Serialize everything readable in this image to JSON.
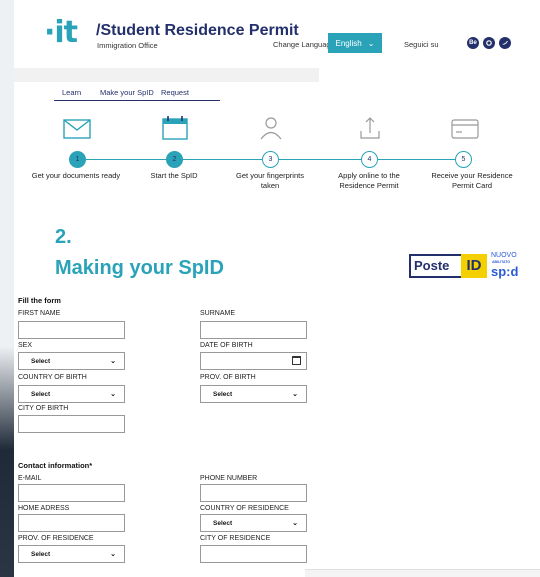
{
  "header": {
    "logo": "·it",
    "title": "/Student Residence Permit",
    "subtitle": "Immigration Office",
    "change_language": "Change Language",
    "language": "English",
    "follow_us": "Seguici su",
    "social": [
      "Be",
      "GitHub",
      "Twitter"
    ]
  },
  "tabs": [
    "Learn",
    "Make your SpID",
    "Request"
  ],
  "steps": [
    {
      "num": "1",
      "label": "Get your documents ready",
      "icon": "envelope-icon",
      "done": true
    },
    {
      "num": "2",
      "label": "Start the SpID",
      "icon": "calendar-icon",
      "done": true
    },
    {
      "num": "3",
      "label": "Get your fingerprints taken",
      "icon": "user-icon",
      "done": false
    },
    {
      "num": "4",
      "label": "Apply online to the Residence Permit",
      "icon": "upload-icon",
      "done": false
    },
    {
      "num": "5",
      "label": "Receive your Residence Permit Card",
      "icon": "card-icon",
      "done": false
    }
  ],
  "section": {
    "number": "2.",
    "title": "Making your SpID",
    "spid_logo": {
      "poste": "Poste",
      "id": "ID",
      "nuovo": "NUOVO",
      "abilitato": "ABILITATO",
      "spid": "sp:d"
    }
  },
  "form": {
    "fill_title": "Fill the form",
    "first_name": "FIRST NAME",
    "surname": "SURNAME",
    "sex": "SEX",
    "date_of_birth": "DATE OF BIRTH",
    "country_of_birth": "COUNTRY OF BIRTH",
    "prov_of_birth": "PROV. OF BIRTH",
    "city_of_birth": "CITY OF BIRTH",
    "select": "Select",
    "contact_title": "Contact information*",
    "email": "E-MAIL",
    "phone": "PHONE NUMBER",
    "home_address": "HOME ADRESS",
    "country_of_residence": "COUNTRY OF RESIDENCE",
    "prov_of_residence": "PROV. OF RESIDENCE",
    "city_of_residence": "CITY OF RESIDENCE"
  },
  "colors": {
    "accent": "#2aa3b8",
    "navy": "#23306b"
  }
}
